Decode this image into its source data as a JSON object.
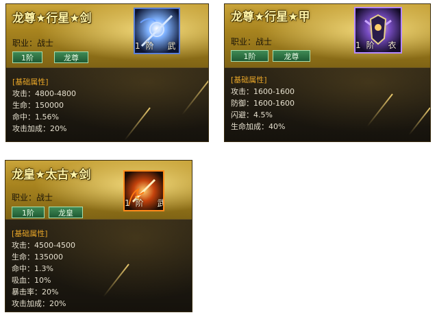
{
  "cards": [
    {
      "title": "龙尊★行星★剑",
      "job_label": "职业：",
      "job_value": "战士",
      "level_badge": "1阶",
      "rank_badge": "龙尊",
      "icon_name": "sword-icon",
      "icon_level": "1阶",
      "icon_type": "武",
      "stats_header": "[基础属性]",
      "stats": [
        "攻击：4800-4800",
        "生命：150000",
        "命中：1.56%",
        "攻击加成：20%"
      ]
    },
    {
      "title": "龙尊★行星★甲",
      "job_label": "职业：",
      "job_value": "战士",
      "level_badge": "1阶",
      "rank_badge": "龙尊",
      "icon_name": "armor-icon",
      "icon_level": "1阶",
      "icon_type": "衣",
      "stats_header": "[基础属性]",
      "stats": [
        "攻击：1600-1600",
        "防御：1600-1600",
        "闪避：4.5%",
        "生命加成：40%"
      ]
    },
    {
      "title": "龙皇★太古★剑",
      "job_label": "职业：",
      "job_value": "战士",
      "level_badge": "1阶",
      "rank_badge": "龙皇",
      "icon_name": "flaming-sword-icon",
      "icon_level": "1阶",
      "icon_type": "武",
      "stats_header": "[基础属性]",
      "stats": [
        "攻击：4500-4500",
        "生命：135000",
        "命中：1.3%",
        "吸血：10%",
        "暴击率：20%",
        "攻击加成：20%"
      ]
    }
  ],
  "colors": {
    "title": "#fff4a8",
    "stats_header": "#e8a628",
    "stats_text": "#e6e0cf",
    "badge_green": "#2f7a46"
  }
}
